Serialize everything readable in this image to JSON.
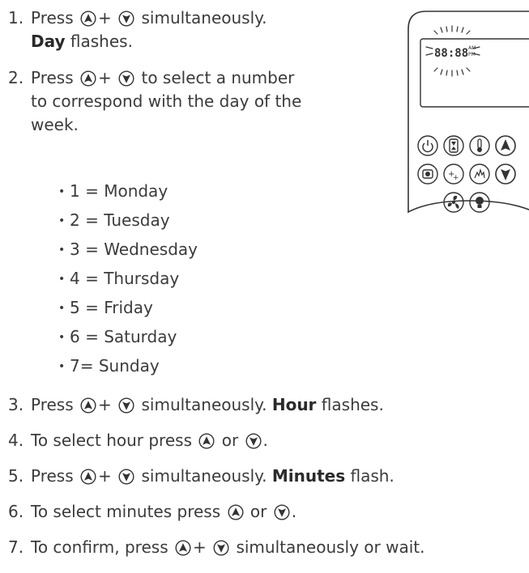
{
  "steps": [
    {
      "number": "1.",
      "line1_pre": "Press",
      "line1_plus": "+",
      "line1_post": "simultaneously.",
      "line2_bold": "Day",
      "line2_post": " flashes."
    },
    {
      "number": "2.",
      "line1_pre": "Press",
      "line1_plus": "+",
      "line1_post": "to select a number",
      "line2": "to correspond with the day of the",
      "line3": "week."
    },
    {
      "number": "3.",
      "pre": "Press",
      "plus": "+",
      "mid": "simultaneously.",
      "bold": "Hour",
      "post": " flashes."
    },
    {
      "number": "4.",
      "pre": "To select hour press",
      "or": "or",
      "post": "."
    },
    {
      "number": "5.",
      "pre": "Press",
      "plus": "+",
      "mid": "simultaneously.",
      "bold": "Minutes",
      "post": " flash."
    },
    {
      "number": "6.",
      "pre": "To select minutes press",
      "or": "or",
      "post": "."
    },
    {
      "number": "7.",
      "pre": "To confirm, press",
      "plus": "+",
      "post": "simultaneously or wait."
    }
  ],
  "days": [
    "1 = Monday",
    "2 = Tuesday",
    "3 = Wednesday",
    "4 = Thursday",
    "5 = Friday",
    "6 = Saturday",
    "7= Sunday"
  ],
  "bullet_char": "•",
  "remote": {
    "display_digits": "88:88",
    "am_label": "AM",
    "pm_label": "PM"
  },
  "icons": {
    "up_button": "up-arrow-button-icon",
    "down_button": "down-arrow-button-icon"
  }
}
